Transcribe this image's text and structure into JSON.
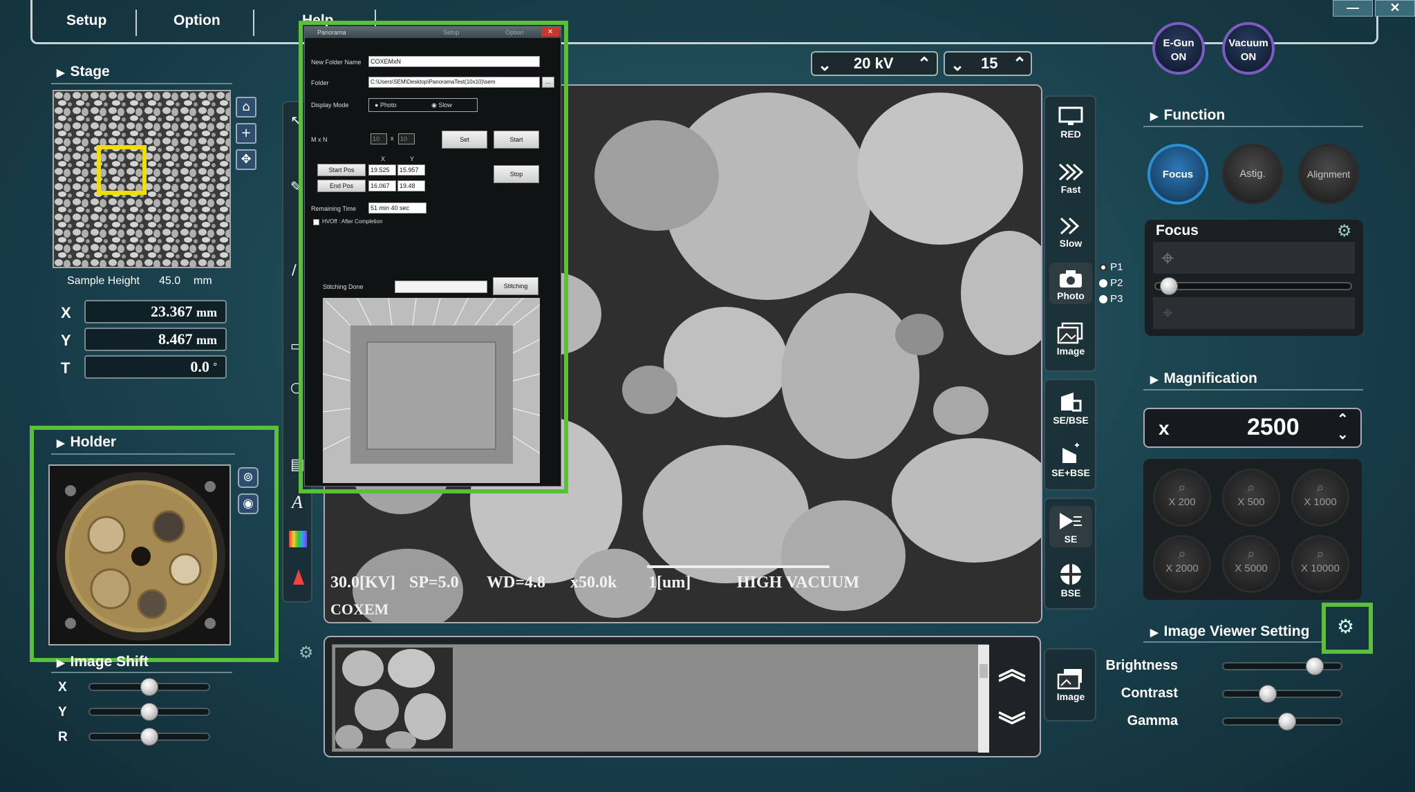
{
  "menu": {
    "setup": "Setup",
    "option": "Option",
    "help": "Help"
  },
  "window": {
    "minimize": "—",
    "close": "✕"
  },
  "beam": {
    "kv_value": "20 kV",
    "spot_value": "15"
  },
  "status_buttons": {
    "egun": "E-Gun\nON",
    "vacuum": "Vacuum\nON"
  },
  "stage": {
    "title": "Stage",
    "sample_height_label": "Sample Height",
    "sample_height_value": "45.0",
    "sample_height_unit": "mm",
    "x_label": "X",
    "x_value": "23.367",
    "x_unit": "mm",
    "y_label": "Y",
    "y_value": "8.467",
    "y_unit": "mm",
    "t_label": "T",
    "t_value": "0.0",
    "t_unit": "°"
  },
  "holder": {
    "title": "Holder"
  },
  "image_shift": {
    "title": "Image Shift",
    "x_label": "X",
    "y_label": "Y",
    "r_label": "R",
    "x_level": 0.5,
    "y_level": 0.5,
    "r_level": 0.5
  },
  "panorama": {
    "title": "Panorama",
    "tab1": "Setup",
    "tab2": "Option",
    "folder_name_label": "New Folder Name",
    "folder_name_value": "COXEMxN",
    "folder_label": "Folder",
    "folder_value": "C:\\Users\\SEM\\Desktop\\PanoramaTest(10x10)\\sem",
    "browse": "...",
    "display_mode_label": "Display Mode",
    "mode_photo": "Photo",
    "mode_slow": "Slow",
    "mxn_label": "M x N",
    "m_value": "10",
    "times": "x",
    "n_value": "10",
    "set_button": "Set",
    "start_button": "Start",
    "x_col": "X",
    "y_col": "Y",
    "start_pos_button": "Start Pos",
    "start_x": "19.525",
    "start_y": "15.957",
    "end_pos_button": "End Pos",
    "end_x": "16.067",
    "end_y": "19.48",
    "stop_button": "Stop",
    "remaining_label": "Remaining Time",
    "remaining_value": "51 min 40 sec",
    "hvoff_label": "HVOff : After Completion",
    "stitching_done_label": "Stitching Done",
    "stitching_button": "Stitching"
  },
  "sem_overlay": {
    "kv": "30.0[KV]",
    "sp": "SP=5.0",
    "wd": "WD=4.8",
    "mag": "x50.0k",
    "scale": "1[um]",
    "mode": "HIGH VACUUM",
    "brand": "COXEM"
  },
  "right_tools": {
    "red": "RED",
    "fast": "Fast",
    "slow": "Slow",
    "photo": "Photo",
    "image": "Image",
    "se_bse": "SE/BSE",
    "se_plus_bse": "SE+BSE",
    "se": "SE",
    "bse": "BSE",
    "image2": "Image"
  },
  "presets": {
    "p1": "P1",
    "p2": "P2",
    "p3": "P3"
  },
  "function": {
    "title": "Function",
    "focus_btn": "Focus",
    "astig_btn": "Astig.",
    "alignment_btn": "Alignment",
    "focus_panel_title": "Focus",
    "focus_level": 0.03
  },
  "magnification": {
    "title": "Magnification",
    "prefix": "x",
    "value": "2500",
    "presets": [
      "X 200",
      "X 500",
      "X 1000",
      "X 2000",
      "X 5000",
      "X 10000"
    ]
  },
  "viewer": {
    "title": "Image Viewer Setting",
    "brightness_label": "Brightness",
    "brightness_level": 0.82,
    "contrast_label": "Contrast",
    "contrast_level": 0.36,
    "gamma_label": "Gamma",
    "gamma_level": 0.55
  },
  "colors": {
    "accent_green": "#5cbf3a",
    "highlight_yellow": "#f0e000",
    "focus_active": "#2a8fd4"
  }
}
